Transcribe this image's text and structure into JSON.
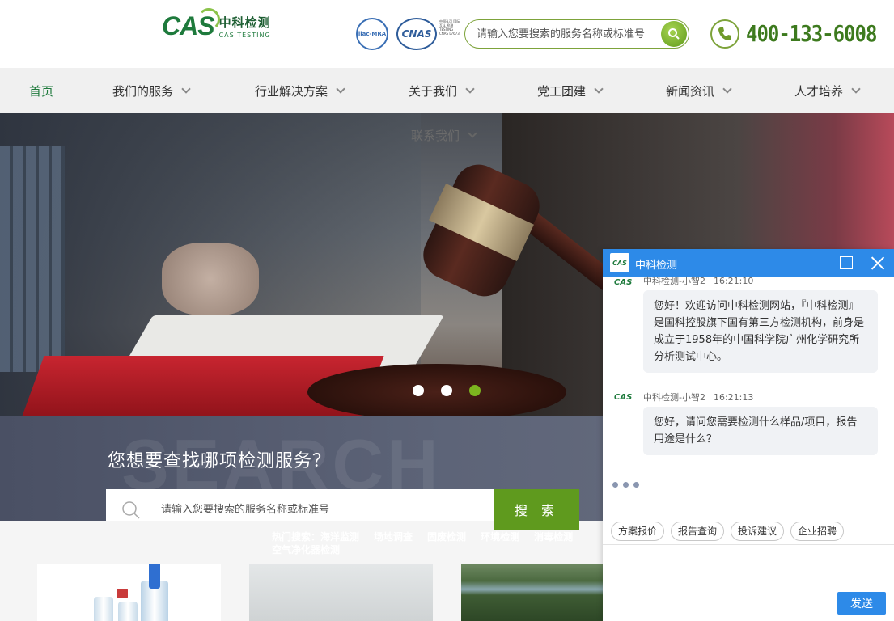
{
  "header": {
    "logo_mark": "CAS",
    "logo_cn": "中科检测",
    "logo_en": "CAS TESTING",
    "cert_ilac": "ilac-MRA",
    "cert_cnas": "CNAS",
    "cert_cnas_note": "中国认可 国际互认 检测 TESTING CNAS L7673",
    "search_placeholder": "请输入您要搜索的服务名称或标准号",
    "phone": "400-133-6008"
  },
  "nav": {
    "items": [
      {
        "label": "首页",
        "has_menu": false
      },
      {
        "label": "我们的服务",
        "has_menu": true
      },
      {
        "label": "行业解决方案",
        "has_menu": true
      },
      {
        "label": "关于我们",
        "has_menu": true
      },
      {
        "label": "党工团建",
        "has_menu": true
      },
      {
        "label": "新闻资讯",
        "has_menu": true
      },
      {
        "label": "人才培养",
        "has_menu": true
      }
    ],
    "overflow_item": "联系我们"
  },
  "banner": {
    "slide_count": 3,
    "active_slide": 3
  },
  "search_section": {
    "bg_word": "SEARCH",
    "title": "您想要查找哪项检测服务？",
    "placeholder": "请输入您要搜索的服务名称或标准号",
    "submit_label": "搜 索",
    "hot_label": "热门搜索：",
    "hot_terms": [
      "海洋监测",
      "场地调查",
      "固废检测",
      "环境检测",
      "消毒检测",
      "空气净化器检测"
    ]
  },
  "chat": {
    "title": "中科检测",
    "avatar_text": "CAS",
    "messages": [
      {
        "sender": "中科检测-小智2",
        "time": "16:21:10",
        "text": "您好！欢迎访问中科检测网站，『中科检测』是国科控股旗下国有第三方检测机构，前身是成立于1958年的中国科学院广州化学研究所分析测试中心。"
      },
      {
        "sender": "中科检测-小智2",
        "time": "16:21:13",
        "text": "您好，请问您需要检测什么样品/项目，报告用途是什么？"
      }
    ],
    "quick_replies": [
      "方案报价",
      "报告查询",
      "投诉建议",
      "企业招聘"
    ],
    "send_label": "发送"
  },
  "colors": {
    "brand_green": "#1e7a3c",
    "accent_green": "#5f9a1e",
    "chat_blue": "#2d8ae8"
  }
}
